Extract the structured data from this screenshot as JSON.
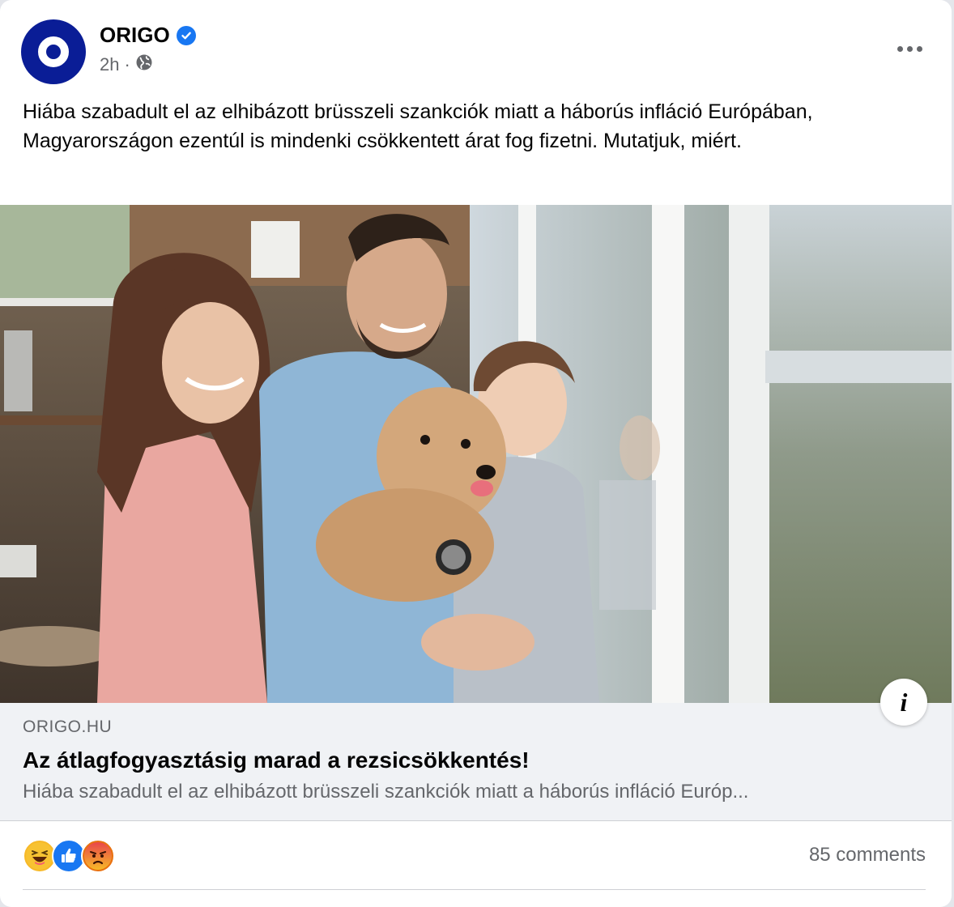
{
  "post": {
    "page_name": "ORIGO",
    "time": "2h",
    "separator": "·",
    "text": "Hiába szabadult el az elhibázott brüsszeli szankciók miatt a háborús infláció Európában, Magyarországon ezentúl is mindenki csökkentett árat fog fizetni. Mutatjuk, miért."
  },
  "link": {
    "domain": "ORIGO.HU",
    "headline": "Az átlagfogyasztásig marad a rezsicsökkentés!",
    "description": "Hiába szabadult el az elhibázott brüsszeli szankciók miatt a háborús infláció Európ...",
    "info_glyph": "i"
  },
  "footer": {
    "comments": "85 comments",
    "reactions": [
      "haha",
      "like",
      "angry"
    ]
  },
  "colors": {
    "brand": "#0a1d96",
    "verified": "#1877f2",
    "secondary_text": "#65676b",
    "link_bg": "#f0f2f5"
  },
  "icons": [
    "verified-badge-icon",
    "globe-icon",
    "more-options-icon",
    "info-icon",
    "haha-reaction-icon",
    "like-reaction-icon",
    "angry-reaction-icon"
  ]
}
